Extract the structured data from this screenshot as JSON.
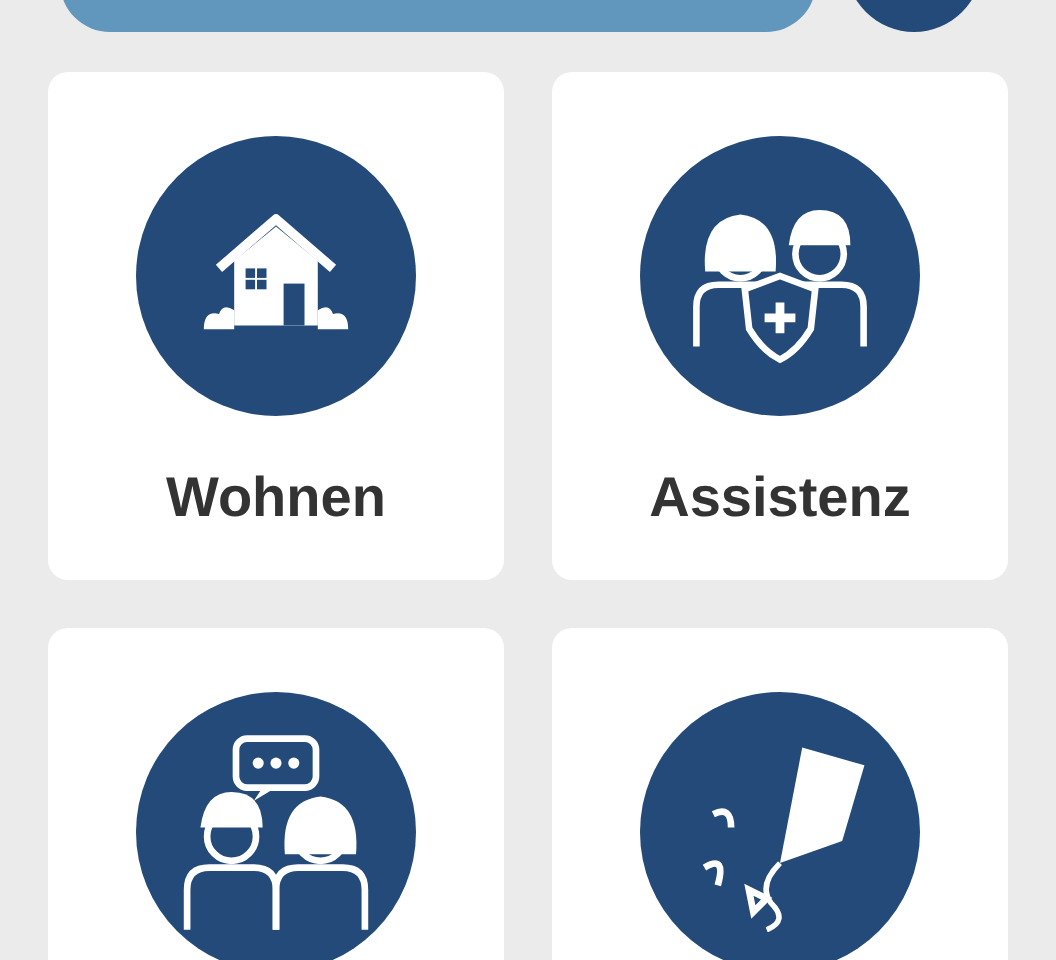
{
  "tiles": [
    {
      "kind": "house",
      "label": "Wohnen"
    },
    {
      "kind": "assist",
      "label": "Assistenz"
    },
    {
      "kind": "chat"
    },
    {
      "kind": "kite"
    }
  ]
}
